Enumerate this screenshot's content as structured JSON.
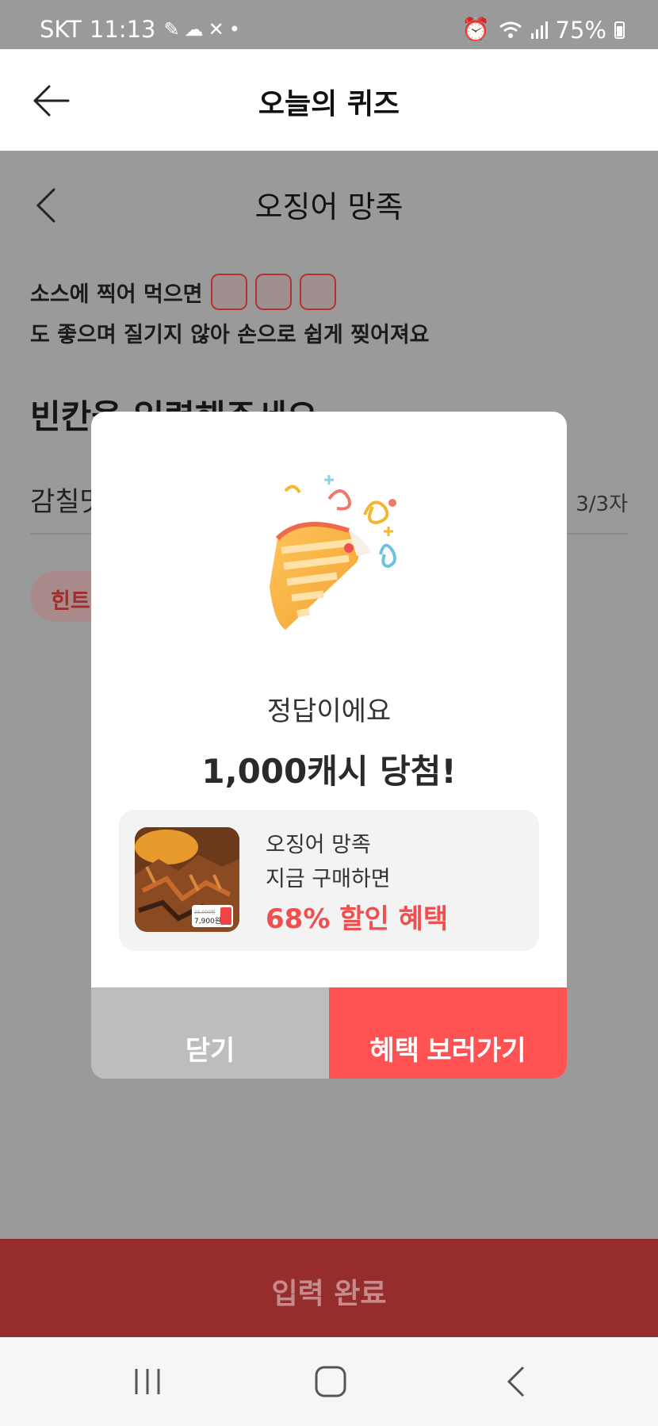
{
  "status_bar": {
    "carrier": "SKT",
    "time": "11:13",
    "battery": "75%"
  },
  "header": {
    "title": "오늘의 퀴즈"
  },
  "quiz": {
    "subtitle": "오징어 망족",
    "question_part1": "소스에 찍어 먹으면",
    "question_part2": "도 좋으며 질기지 않아  손으로 쉽게 찢어져요",
    "instruction": "빈칸을 입력해주세요",
    "answer_value": "감칠맛",
    "char_count": "3/3자",
    "hint_label": "힌트"
  },
  "submit_label": "입력 완료",
  "modal": {
    "result_text": "정답이에요",
    "prize_text": "1,000캐시 당첨!",
    "product": {
      "name": "오징어 망족",
      "sub": "지금 구매하면",
      "benefit": "68% 할인 혜택",
      "price_tag": "7,900원",
      "original_price": "25,000원"
    },
    "close_label": "닫기",
    "benefit_label": "혜택 보러가기"
  },
  "colors": {
    "accent": "#ff5353",
    "benefit_text": "#ef4f4f",
    "submit_dimmed": "#952d2d",
    "overlay": "#9a9a9a"
  },
  "icons": [
    "back-arrow-icon",
    "chevron-left-icon",
    "party-popper-icon",
    "recent-apps-icon",
    "home-icon",
    "nav-back-icon"
  ]
}
